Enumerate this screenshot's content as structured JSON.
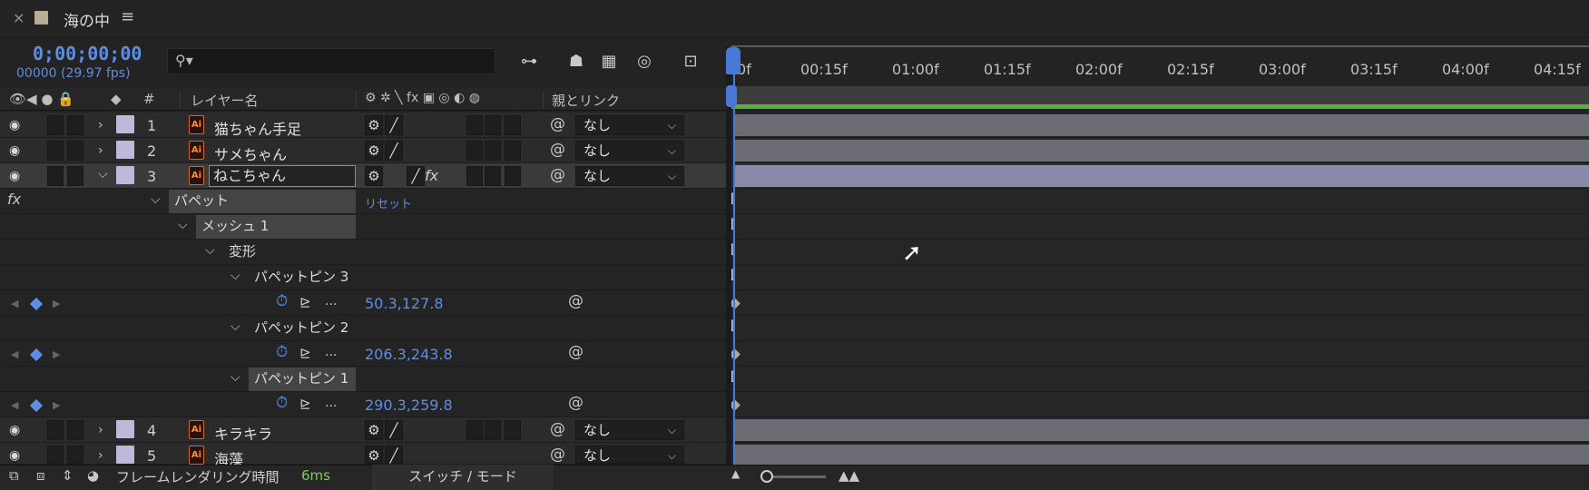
{
  "tab": {
    "title": "海の中",
    "close": "×",
    "menu": "≡"
  },
  "header": {
    "timecode": "0;00;00;00",
    "fps": "00000 (29.97 fps)"
  },
  "ruler": [
    "0f",
    "00:15f",
    "01:00f",
    "01:15f",
    "02:00f",
    "02:15f",
    "03:00f",
    "03:15f",
    "04:00f",
    "04:15f"
  ],
  "columns": {
    "num": "#",
    "layer_name": "レイヤー名",
    "parent": "親とリンク",
    "switches": "⚙ ✲ ╲ fx ▣ ◎ ◐ ◍"
  },
  "layers_top": [
    {
      "num": "1",
      "name": "猫ちゃん手足",
      "parent": "なし"
    },
    {
      "num": "2",
      "name": "サメちゃん",
      "parent": "なし"
    },
    {
      "num": "3",
      "name": "ねこちゃん",
      "parent": "なし"
    }
  ],
  "effects": {
    "fx_icon": "fx",
    "puppet": "パペット",
    "reset": "リセット",
    "mesh": "メッシュ 1",
    "deform": "変形",
    "pins": [
      {
        "name": "パペットピン 3",
        "value": "50.3,127.8"
      },
      {
        "name": "パペットピン 2",
        "value": "206.3,243.8"
      },
      {
        "name": "パペットピン 1",
        "value": "290.3,259.8"
      }
    ],
    "dots": "..."
  },
  "layers_bottom": [
    {
      "num": "4",
      "name": "キラキラ",
      "parent": "なし"
    },
    {
      "num": "5",
      "name": "海藻",
      "parent": "なし"
    }
  ],
  "bottom": {
    "render_label": "フレームレンダリング時間",
    "render_value": "6ms",
    "switch_mode": "スイッチ / モード"
  },
  "colors": {
    "accent_blue": "#5e8de5",
    "work_area_green": "#59b03a",
    "label_lavender": "#c0b8d8"
  }
}
